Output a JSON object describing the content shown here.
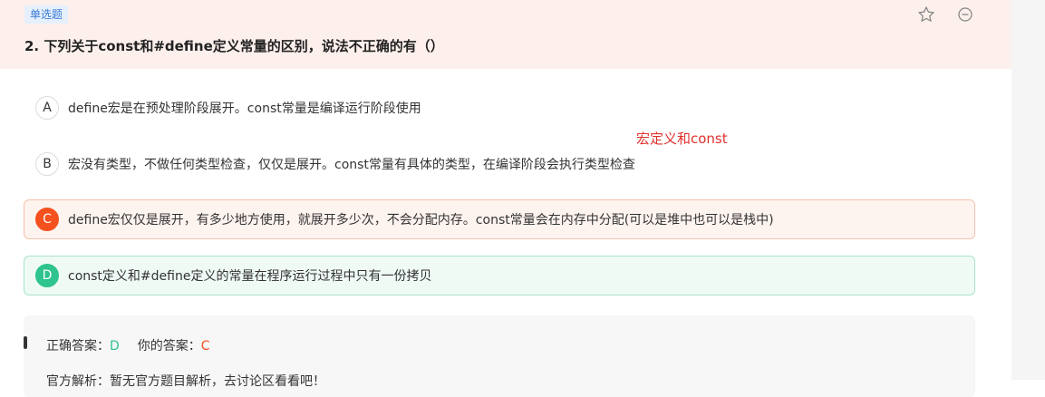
{
  "question": {
    "type_badge": "单选题",
    "title": "2. 下列关于const和#define定义常量的区别，说法不正确的有（）"
  },
  "options": [
    {
      "letter": "A",
      "text": "define宏是在预处理阶段展开。const常量是编译运行阶段使用"
    },
    {
      "letter": "B",
      "text": "宏没有类型，不做任何类型检查，仅仅是展开。const常量有具体的类型，在编译阶段会执行类型检查"
    },
    {
      "letter": "C",
      "text": "define宏仅仅是展开，有多少地方使用，就展开多少次，不会分配内存。const常量会在内存中分配(可以是堆中也可以是栈中)"
    },
    {
      "letter": "D",
      "text": "const定义和#define定义的常量在程序运行过程中只有一份拷贝"
    }
  ],
  "annotation": "宏定义和const",
  "answer": {
    "correct_label": "正确答案：",
    "correct_value": "D",
    "yours_label": "你的答案：",
    "yours_value": "C",
    "analysis": "官方解析：暂无官方题目解析，去讨论区看看吧！"
  },
  "colors": {
    "accent_wrong": "#f4511e",
    "accent_right": "#2fc48d",
    "annotation": "#e0322d",
    "header_bg": "#fdf0ec"
  },
  "icons": {
    "favorite": "star-icon",
    "more": "minus-circle-icon"
  }
}
